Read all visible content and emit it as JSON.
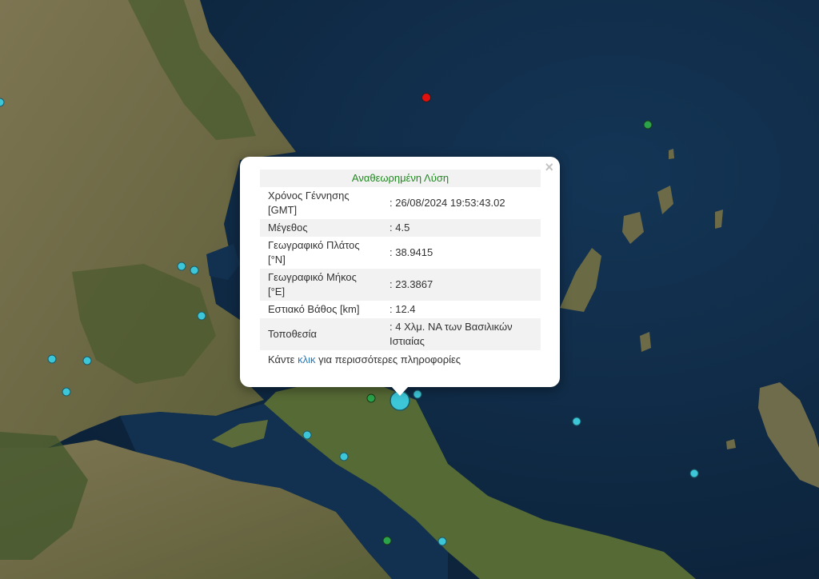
{
  "popup": {
    "title": "Αναθεωρημένη Λύση",
    "close_symbol": "×",
    "rows": [
      {
        "label": "Χρόνος Γέννησης [GMT]",
        "value": ": 26/08/2024 19:53:43.02"
      },
      {
        "label": "Μέγεθος",
        "value": ": 4.5"
      },
      {
        "label": "Γεωγραφικό Πλάτος [°N]",
        "value": ": 38.9415"
      },
      {
        "label": "Γεωγραφικό Μήκος [°E]",
        "value": ": 23.3867"
      },
      {
        "label": "Εστιακό Βάθος [km]",
        "value": ": 12.4"
      },
      {
        "label": "Τοποθεσία",
        "value": ": 4 Χλμ. ΝΑ των Βασιλικών Ιστιαίας"
      }
    ],
    "footer_prefix": "Κάντε ",
    "footer_link": "κλικ",
    "footer_suffix": " για περισσότερες πληροφορίες"
  },
  "colors": {
    "sea": "#0f2a45",
    "sea_deep": "#0b2036",
    "land": "#6f6a48",
    "forest": "#3c5a2a",
    "marker_cyan": "#3cc6d8",
    "marker_green": "#2aa34a",
    "marker_red": "#e01010",
    "title_green": "#218a21",
    "link_blue": "#2a7ab8"
  }
}
